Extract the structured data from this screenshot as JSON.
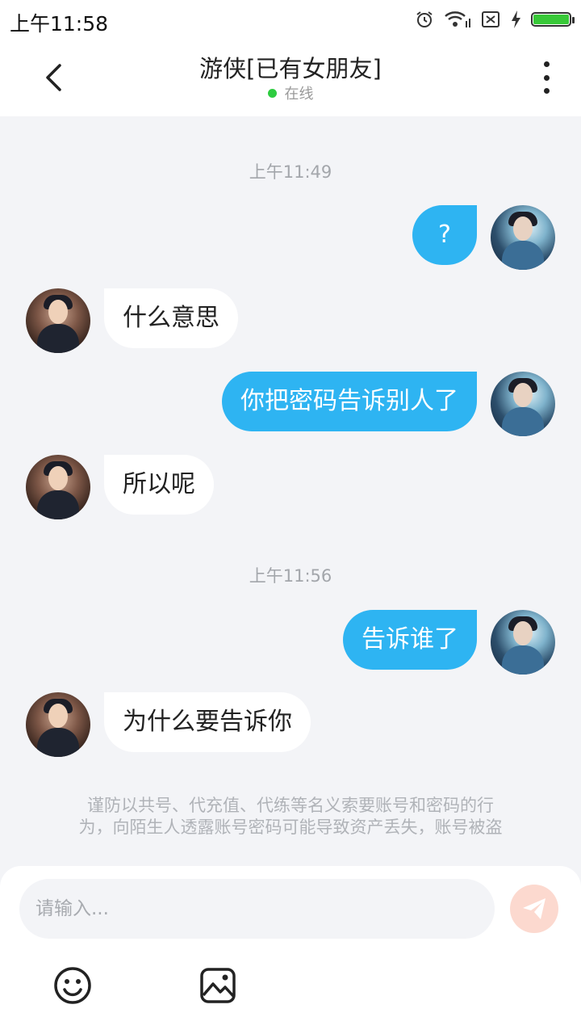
{
  "status_bar": {
    "time": "上午11:58"
  },
  "header": {
    "title": "游侠[已有女朋友]",
    "status": "在线"
  },
  "messages": [
    {
      "time": "上午11:49"
    },
    {
      "from": "me",
      "text": "?"
    },
    {
      "from": "them",
      "text": "什么意思"
    },
    {
      "from": "me",
      "text": "你把密码告诉别人了"
    },
    {
      "from": "them",
      "text": "所以呢"
    },
    {
      "time": "上午11:56"
    },
    {
      "from": "me",
      "text": "告诉谁了"
    },
    {
      "from": "them",
      "text": "为什么要告诉你"
    }
  ],
  "notice": {
    "line1": "谨防以共号、代充值、代练等名义索要账号和密码的行",
    "line2": "为，向陌生人透露账号密码可能导致资产丢失，账号被盗"
  },
  "input": {
    "placeholder": "请输入..."
  },
  "colors": {
    "outgoing_bubble": "#2eb4f2",
    "incoming_bubble": "#ffffff",
    "online": "#2ecc40",
    "send": "#fcd9cf"
  },
  "icons": [
    "alarm-icon",
    "wifi-icon",
    "sim-icon",
    "charging-icon",
    "battery-icon",
    "back-icon",
    "more-icon",
    "send-icon",
    "emoji-icon",
    "image-icon"
  ]
}
